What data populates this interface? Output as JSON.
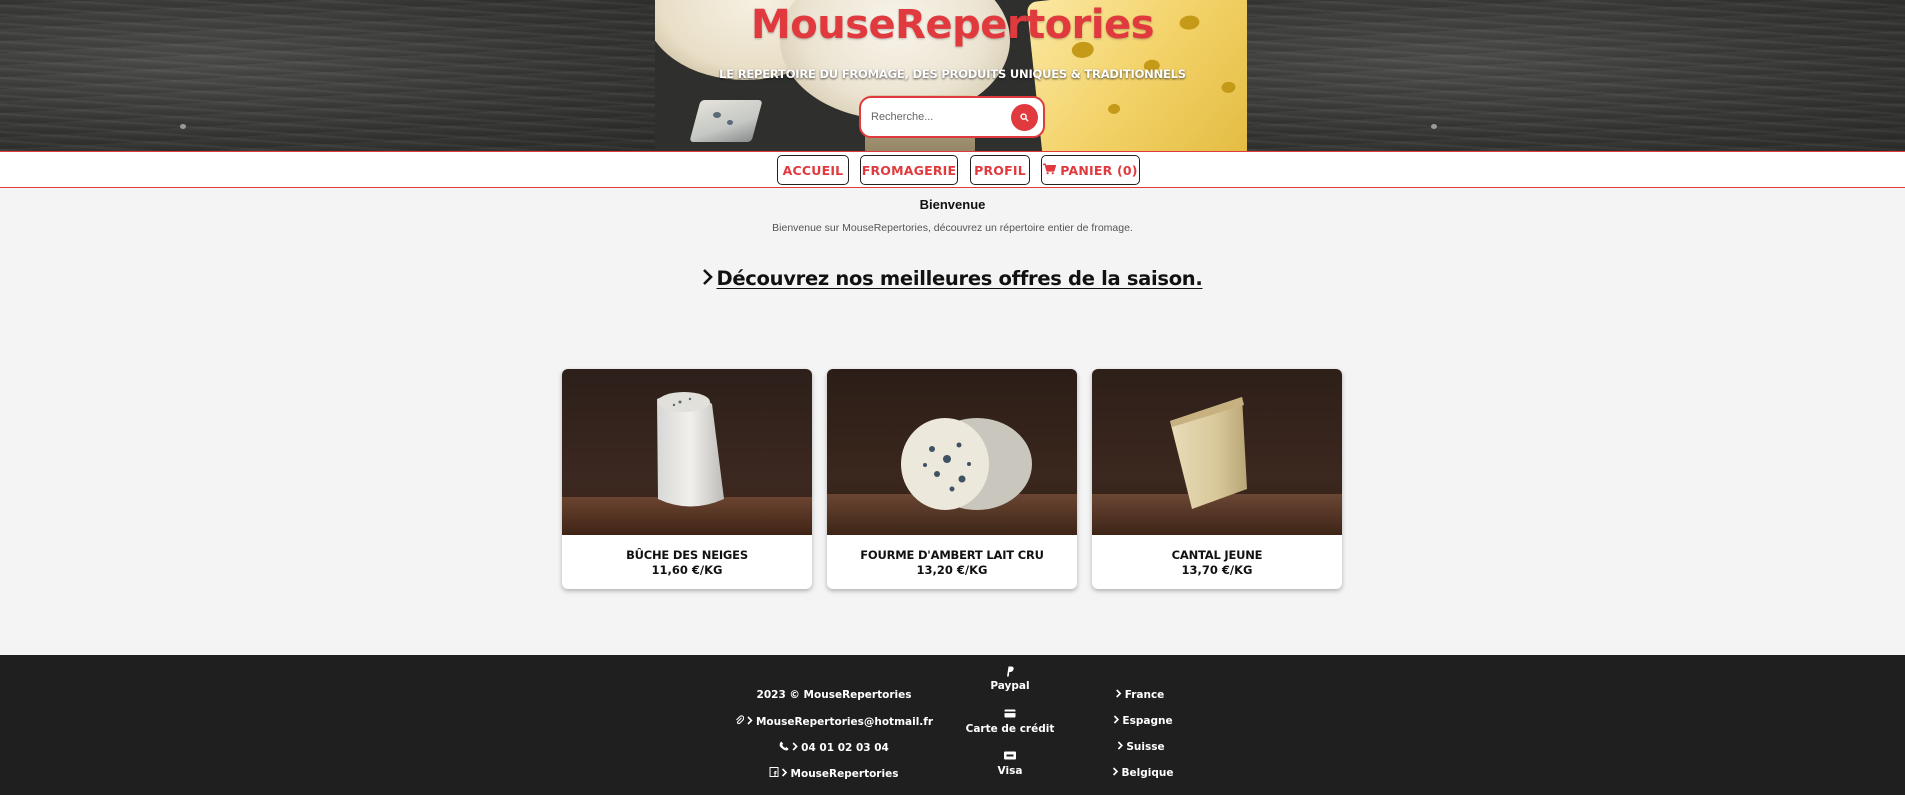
{
  "header": {
    "brand": "MouseRepertories",
    "tagline": "LE REPERTOIRE DU FROMAGE, DES PRODUITS UNIQUES & TRADITIONNELS",
    "search_placeholder": "Recherche..."
  },
  "nav": {
    "items": [
      {
        "label": "ACCUEIL"
      },
      {
        "label": "FROMAGERIE"
      },
      {
        "label": "PROFIL"
      },
      {
        "label": "PANIER (0)",
        "icon": "cart-icon"
      }
    ]
  },
  "welcome": {
    "title": "Bienvenue",
    "text": "Bienvenue sur MouseRepertories, découvrez un répertoire entier de fromage."
  },
  "offers_heading": "Découvrez nos meilleures offres de la saison.",
  "products": [
    {
      "name": "BÛCHE DES NEIGES",
      "price": "11,60 €/KG"
    },
    {
      "name": "FOURME D'AMBERT LAIT CRU",
      "price": "13,20 €/KG"
    },
    {
      "name": "CANTAL JEUNE",
      "price": "13,70 €/KG"
    }
  ],
  "footer": {
    "contact": [
      {
        "text": "2023 © MouseRepertories",
        "icon": ""
      },
      {
        "text": "MouseRepertories@hotmail.fr",
        "icon": "paperclip-icon"
      },
      {
        "text": "04 01 02 03 04",
        "icon": "phone-icon"
      },
      {
        "text": "MouseRepertories",
        "icon": "facebook-icon"
      }
    ],
    "payments": [
      {
        "label": "Paypal",
        "icon": "paypal-icon"
      },
      {
        "label": "Carte de crédit",
        "icon": "credit-card-icon"
      },
      {
        "label": "Visa",
        "icon": "visa-icon"
      }
    ],
    "countries": [
      "France",
      "Espagne",
      "Suisse",
      "Belgique"
    ]
  },
  "colors": {
    "accent": "#e03a3e",
    "footer_bg": "#1f1f1f",
    "page_bg": "#f3f4f3"
  }
}
